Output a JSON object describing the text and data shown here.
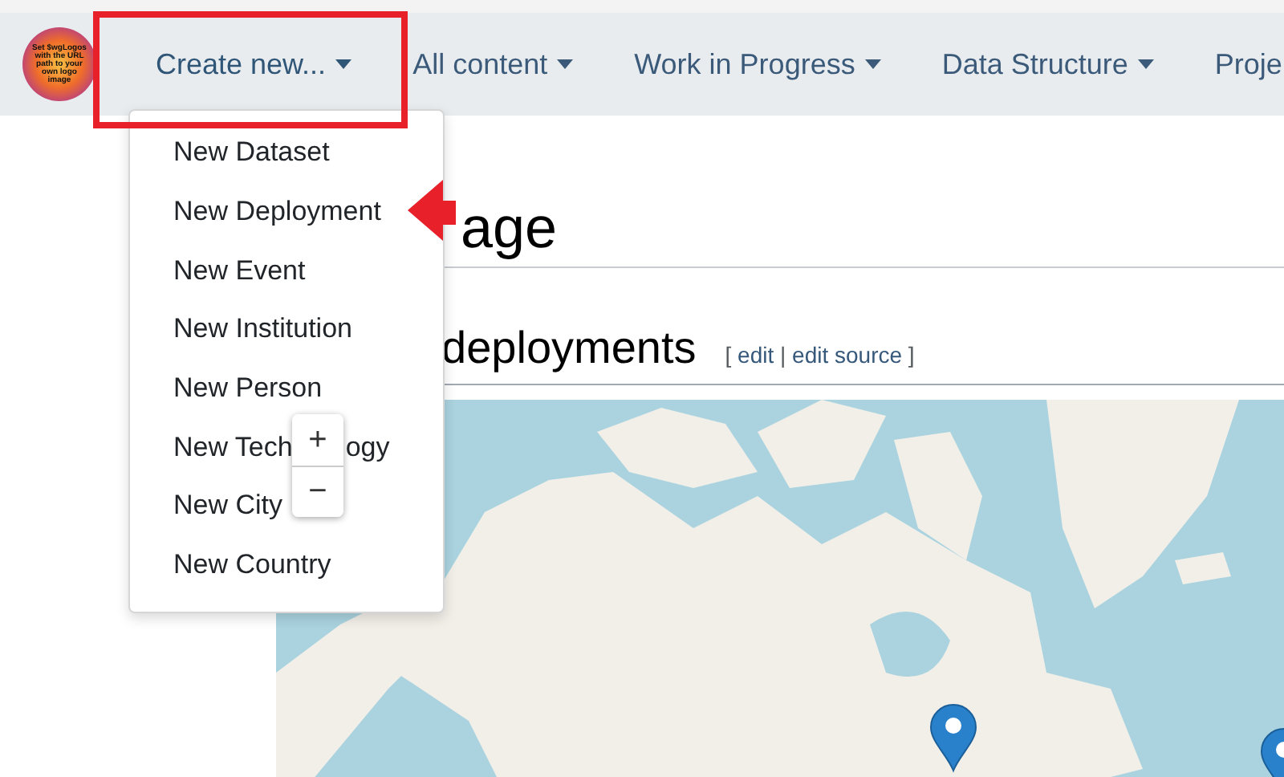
{
  "logo": {
    "text": "Set $wgLogos with the URL path to your own logo image"
  },
  "nav": [
    {
      "label": "Create new...",
      "caret": true,
      "expanded": true
    },
    {
      "label": "All content",
      "caret": true,
      "expanded": false
    },
    {
      "label": "Work in Progress",
      "caret": true,
      "expanded": false
    },
    {
      "label": "Data Structure",
      "caret": true,
      "expanded": false
    },
    {
      "label": "Proje",
      "caret": false,
      "expanded": false
    }
  ],
  "dropdown": [
    {
      "label": "New Dataset"
    },
    {
      "label": "New Deployment"
    },
    {
      "label": "New Event"
    },
    {
      "label": "New Institution"
    },
    {
      "label": "New Person"
    },
    {
      "label": "New Tech",
      "label_tail": "ogy"
    },
    {
      "label": "New City"
    },
    {
      "label": "New Country"
    }
  ],
  "page_title": "age",
  "section": {
    "title": "deployments",
    "edit_links": {
      "open": "[",
      "edit": "edit",
      "sep": "|",
      "edit_source": "edit source",
      "close": "]"
    }
  },
  "map": {
    "kind": "picture",
    "zoom_in": "+",
    "zoom_out": "−"
  }
}
